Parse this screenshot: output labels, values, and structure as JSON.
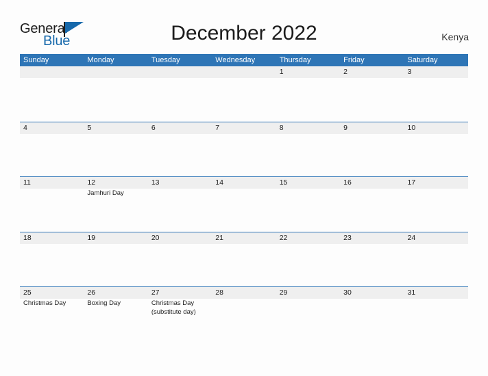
{
  "brand": {
    "name_part1": "General",
    "name_part2": "Blue",
    "flag_icon": "blue-flag-icon"
  },
  "header": {
    "title": "December 2022",
    "country": "Kenya"
  },
  "colors": {
    "header_blue": "#2e75b6",
    "band_gray": "#efefef",
    "brand_blue": "#1769ab",
    "text_dark": "#1c1c1c",
    "page_bg": "#fdfdfd"
  },
  "calendar": {
    "month": "December",
    "year": "2022",
    "weekday_headers": [
      "Sunday",
      "Monday",
      "Tuesday",
      "Wednesday",
      "Thursday",
      "Friday",
      "Saturday"
    ],
    "weeks": [
      {
        "days": [
          {
            "number": "",
            "events": []
          },
          {
            "number": "",
            "events": []
          },
          {
            "number": "",
            "events": []
          },
          {
            "number": "",
            "events": []
          },
          {
            "number": "1",
            "events": []
          },
          {
            "number": "2",
            "events": []
          },
          {
            "number": "3",
            "events": []
          }
        ]
      },
      {
        "days": [
          {
            "number": "4",
            "events": []
          },
          {
            "number": "5",
            "events": []
          },
          {
            "number": "6",
            "events": []
          },
          {
            "number": "7",
            "events": []
          },
          {
            "number": "8",
            "events": []
          },
          {
            "number": "9",
            "events": []
          },
          {
            "number": "10",
            "events": []
          }
        ]
      },
      {
        "days": [
          {
            "number": "11",
            "events": []
          },
          {
            "number": "12",
            "events": [
              "Jamhuri Day"
            ]
          },
          {
            "number": "13",
            "events": []
          },
          {
            "number": "14",
            "events": []
          },
          {
            "number": "15",
            "events": []
          },
          {
            "number": "16",
            "events": []
          },
          {
            "number": "17",
            "events": []
          }
        ]
      },
      {
        "days": [
          {
            "number": "18",
            "events": []
          },
          {
            "number": "19",
            "events": []
          },
          {
            "number": "20",
            "events": []
          },
          {
            "number": "21",
            "events": []
          },
          {
            "number": "22",
            "events": []
          },
          {
            "number": "23",
            "events": []
          },
          {
            "number": "24",
            "events": []
          }
        ]
      },
      {
        "days": [
          {
            "number": "25",
            "events": [
              "Christmas Day"
            ]
          },
          {
            "number": "26",
            "events": [
              "Boxing Day"
            ]
          },
          {
            "number": "27",
            "events": [
              "Christmas Day\n(substitute day)"
            ]
          },
          {
            "number": "28",
            "events": []
          },
          {
            "number": "29",
            "events": []
          },
          {
            "number": "30",
            "events": []
          },
          {
            "number": "31",
            "events": []
          }
        ]
      }
    ]
  }
}
